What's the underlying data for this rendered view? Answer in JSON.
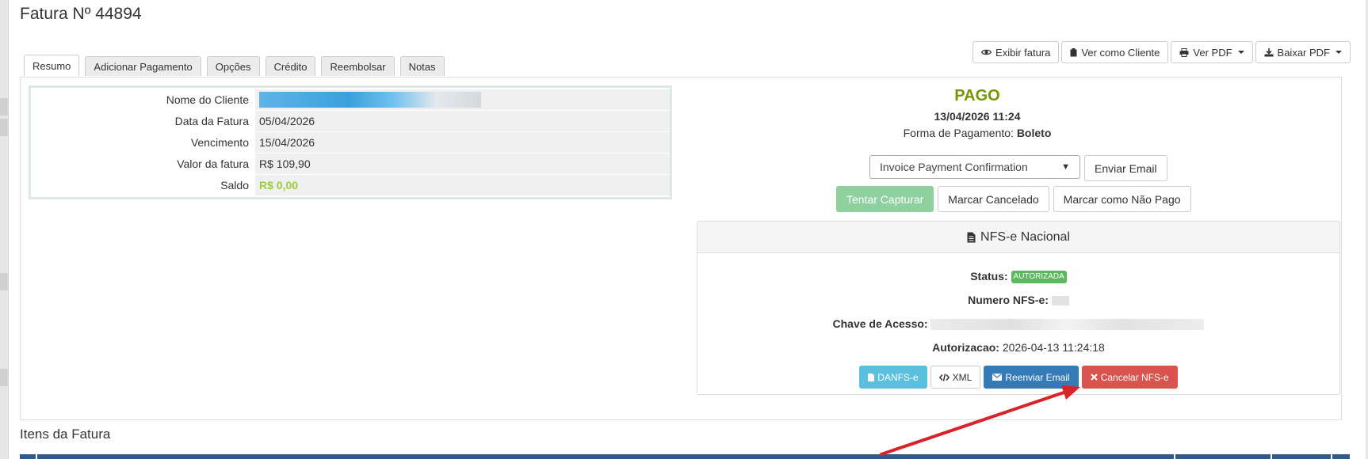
{
  "page": {
    "title": "Fatura Nº 44894"
  },
  "top_buttons": [
    {
      "label": "Exibir fatura",
      "icon": "eye-icon"
    },
    {
      "label": "Ver como Cliente",
      "icon": "clipboard-icon"
    },
    {
      "label": "Ver PDF",
      "icon": "print-icon",
      "dropdown": true
    },
    {
      "label": "Baixar PDF",
      "icon": "download-icon",
      "dropdown": true
    }
  ],
  "tabs": [
    {
      "label": "Resumo",
      "active": true
    },
    {
      "label": "Adicionar Pagamento"
    },
    {
      "label": "Opções"
    },
    {
      "label": "Crédito"
    },
    {
      "label": "Reembolsar"
    },
    {
      "label": "Notas"
    }
  ],
  "client_info": {
    "rows": [
      {
        "label": "Nome do Cliente",
        "value": ""
      },
      {
        "label": "Data da Fatura",
        "value": "05/04/2026"
      },
      {
        "label": "Vencimento",
        "value": "15/04/2026"
      },
      {
        "label": "Valor da fatura",
        "value": "R$ 109,90"
      },
      {
        "label": "Saldo",
        "value": "R$ 0,00"
      }
    ]
  },
  "status": {
    "label": "PAGO",
    "paid_at": "13/04/2026 11:24",
    "payment_method_label": "Forma de Pagamento:",
    "payment_method": "Boleto"
  },
  "email": {
    "template_selected": "Invoice Payment Confirmation",
    "send_label": "Enviar Email"
  },
  "actions": {
    "capture": "Tentar Capturar",
    "mark_cancelled": "Marcar Cancelado",
    "mark_unpaid": "Marcar como Não Pago"
  },
  "nfse": {
    "title": "NFS-e Nacional",
    "status_label": "Status:",
    "status_badge": "AUTORIZADA",
    "number_label": "Numero NFS-e:",
    "key_label": "Chave de Acesso:",
    "auth_label": "Autorizacao:",
    "auth_value": "2026-04-13 11:24:18",
    "buttons": {
      "danfse": "DANFS-e",
      "xml": "XML",
      "resend": "Reenviar Email",
      "cancel": "Cancelar NFS-e"
    }
  },
  "items": {
    "title": "Itens da Fatura"
  },
  "colors": {
    "paid": "#779500",
    "balance": "#9acd32",
    "success_btn": "#8fd19e",
    "badge": "#5cb85c",
    "info": "#5bc0de",
    "primary": "#337ab7",
    "danger": "#d9534f",
    "annotation_arrow": "#d9232a",
    "items_header": "#2f5a8a"
  }
}
